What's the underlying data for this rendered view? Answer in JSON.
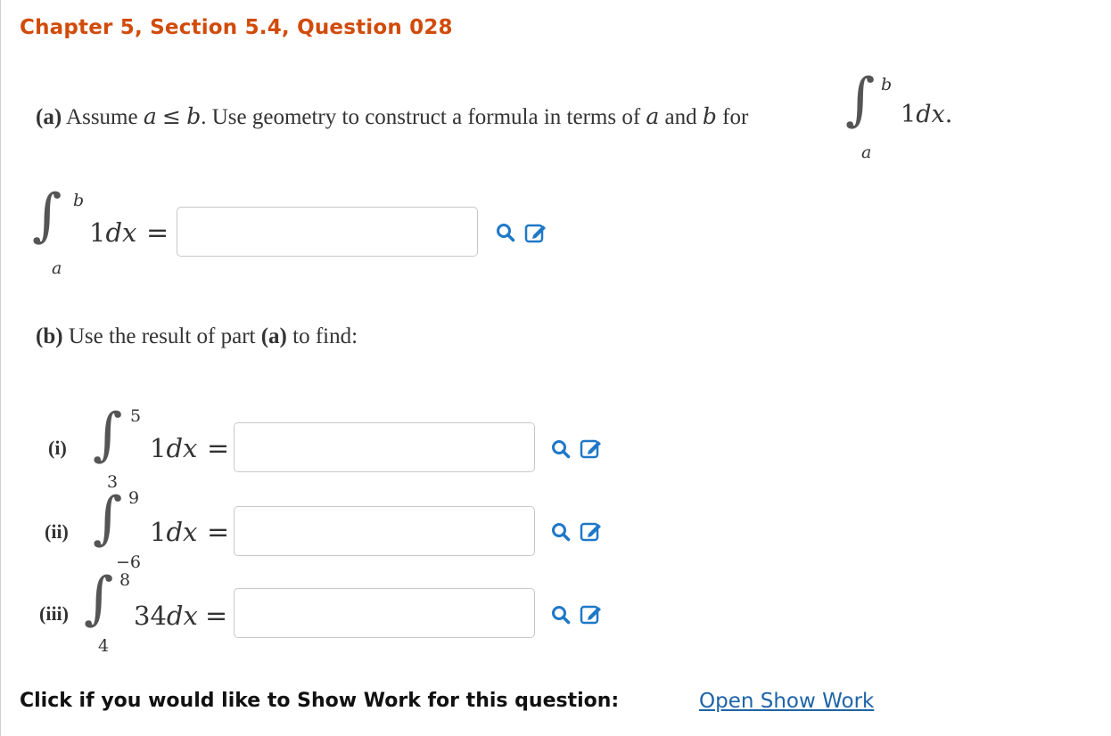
{
  "header": {
    "title": "Chapter 5, Section 5.4, Question 028"
  },
  "part_a": {
    "label": "(a)",
    "text_assume": "Assume",
    "var_a": "a",
    "leq": "≤",
    "var_b": "b",
    "text_use": ". Use geometry to construct a formula in terms of",
    "var_a2": "a",
    "and": "and",
    "var_b2": "b",
    "for": "for",
    "integral": {
      "upper": "b",
      "lower": "a",
      "integrand": "1",
      "dx": "dx",
      "period": "."
    },
    "answer_integral": {
      "upper": "b",
      "lower": "a",
      "integrand": "1",
      "dx": "dx",
      "eq": "="
    },
    "answer_value": ""
  },
  "part_b": {
    "label": "(b)",
    "text": "Use the result of part",
    "ref": "(a)",
    "text2": "to find:",
    "items": [
      {
        "roman": "(i)",
        "upper": "5",
        "lower": "3",
        "integrand": "1",
        "dx": "dx",
        "eq": "=",
        "value": ""
      },
      {
        "roman": "(ii)",
        "upper": "9",
        "lower": "−6",
        "integrand": "1",
        "dx": "dx",
        "eq": "=",
        "value": ""
      },
      {
        "roman": "(iii)",
        "upper": "8",
        "lower": "4",
        "integrand": "34",
        "dx": "dx",
        "eq": "=",
        "value": ""
      }
    ]
  },
  "show_work": {
    "prompt": "Click if you would like to Show Work for this question:",
    "link": "Open Show Work"
  },
  "colors": {
    "title": "#d14b0a",
    "icon_blue": "#1e78c8",
    "link": "#1e64a8"
  },
  "icons": [
    "search-icon",
    "edit-icon"
  ]
}
